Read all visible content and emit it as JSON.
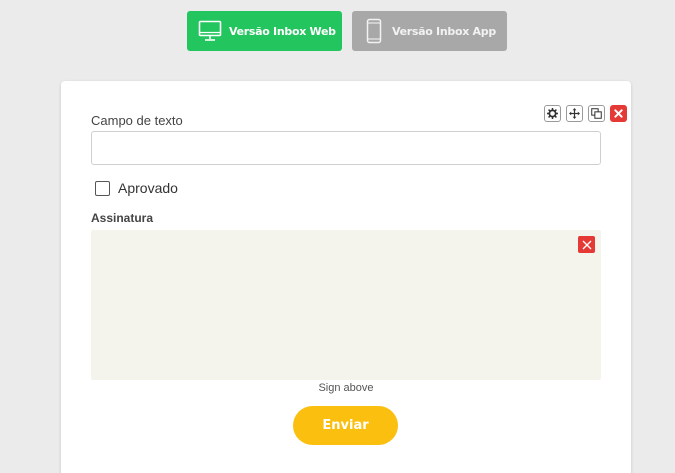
{
  "header": {
    "web_version": {
      "label": "Versão Inbox Web",
      "icon": "monitor-icon",
      "color": "#22c55e"
    },
    "app_version": {
      "label": "Versão Inbox App",
      "icon": "smartphone-icon",
      "color": "#a8a8a8"
    }
  },
  "form": {
    "toolbar": {
      "icons": [
        "gear-icon",
        "move-icon",
        "duplicate-icon",
        "close-icon"
      ],
      "delete_color": "#e53935"
    },
    "text_field": {
      "label": "Campo de texto",
      "value": "",
      "placeholder": ""
    },
    "checkbox": {
      "label": "Aprovado",
      "checked": false
    },
    "signature": {
      "label": "Assinatura",
      "hint": "Sign above",
      "pad_color": "#f4f4ec",
      "clear_icon": "close-icon"
    },
    "submit": {
      "label": "Enviar",
      "color": "#fbbf0f"
    }
  }
}
